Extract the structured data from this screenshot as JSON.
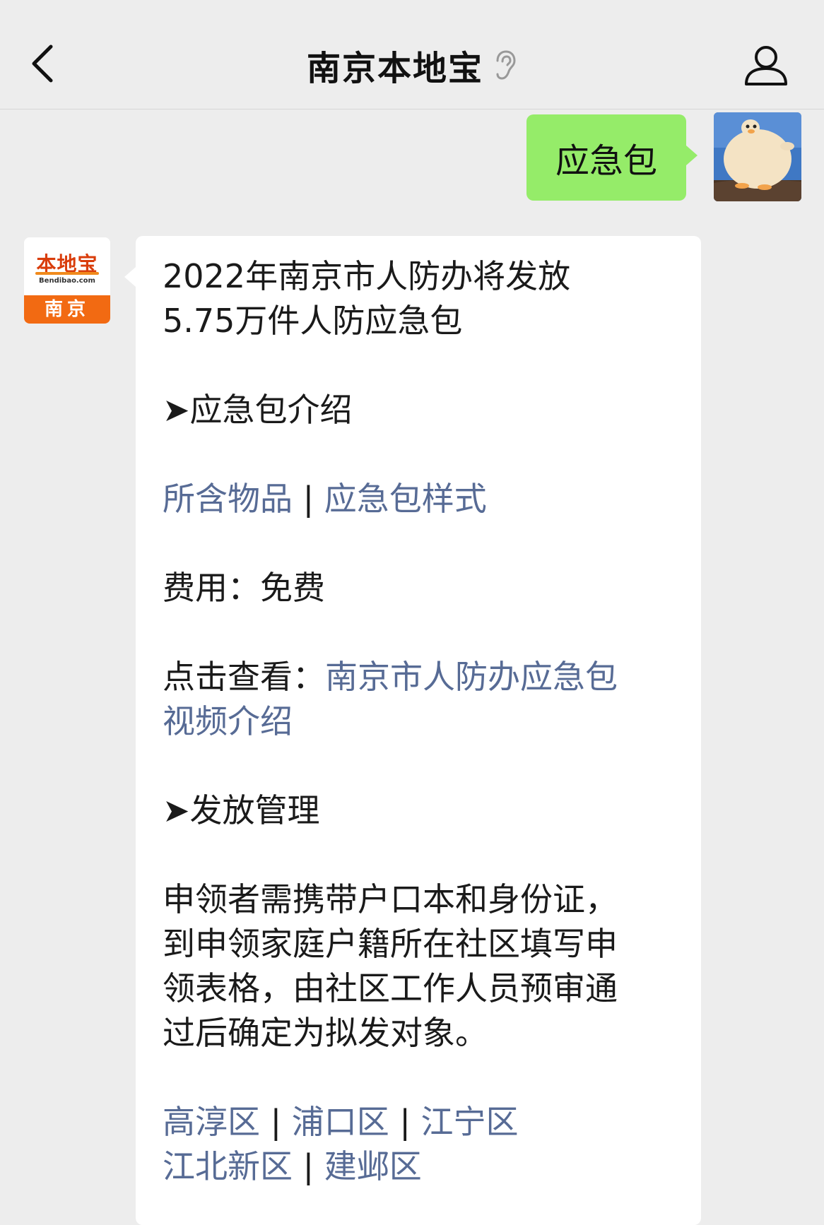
{
  "header": {
    "title": "南京本地宝",
    "back_icon": "chevron-left-icon",
    "ear_icon": "ear-icon",
    "profile_icon": "person-icon"
  },
  "sent": {
    "text": "应急包"
  },
  "bot_avatar": {
    "brand": "本地宝",
    "url": "Bendibao.com",
    "city": "南京"
  },
  "message": {
    "title_line1": "2022年南京市人防办将发放",
    "title_line2": "5.75万件人防应急包",
    "section1": "➤应急包介绍",
    "links1": [
      "所含物品",
      "应急包样式"
    ],
    "fee": "费用：免费",
    "view_prefix": "点击查看：",
    "view_link_line1": "南京市人防办应急包",
    "view_link_line2": "视频介绍",
    "section2": "➤发放管理",
    "para_lines": [
      "申领者需携带户口本和身份证，",
      "到申领家庭户籍所在社区填写申",
      "领表格，由社区工作人员预审通",
      "过后确定为拟发对象。"
    ],
    "districts_row1": [
      "高淳区",
      "浦口区",
      "江宁区"
    ],
    "districts_row2": [
      "江北新区",
      "建邺区"
    ],
    "separator": "|"
  },
  "colors": {
    "background": "#ededed",
    "sent_bubble": "#95ec69",
    "link": "#576b95",
    "brand_orange": "#f26a12"
  }
}
